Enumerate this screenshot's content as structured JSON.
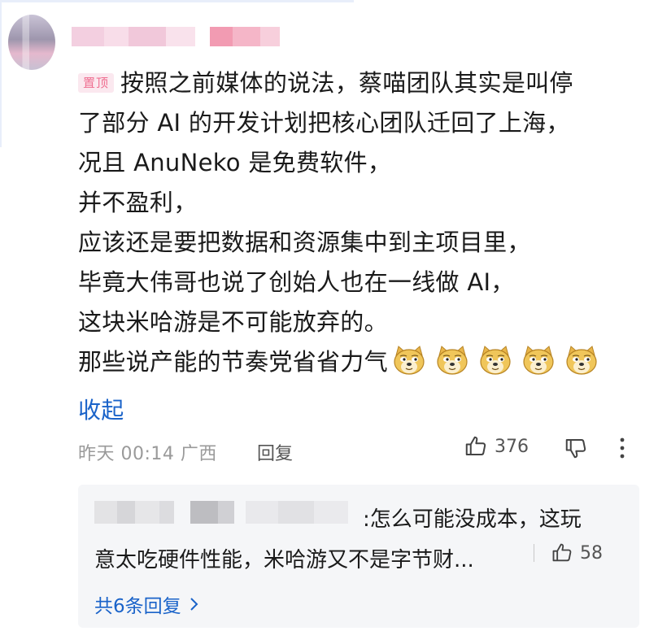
{
  "comment": {
    "pin_label": "置顶",
    "first_line": "按照之前媒体的说法，蔡喵团队其实是叫停",
    "lines": [
      "了部分 AI 的开发计划把核心团队迁回了上海，",
      "况且 AnuNeko 是免费软件，",
      "并不盈利，",
      "应该还是要把数据和资源集中到主项目里，",
      "毕竟大伟哥也说了创始人也在一线做 AI，",
      "这块米哈游是不可能放弃的。"
    ],
    "last_line": "那些说产能的节奏党省省力气",
    "emoji_icon": "doge-emoji",
    "emoji_count": 5,
    "collapse_label": "收起",
    "time": "昨天 00:14 广西",
    "reply_label": "回复",
    "like_count": "376"
  },
  "reply_preview": {
    "line1": "怎么可能没成本，这玩",
    "line2": "意太吃硬件性能，米哈游又不是字节财...",
    "like_count": "58",
    "more_replies": "共6条回复"
  },
  "colors": {
    "link": "#1a63c9",
    "pin_bg": "#fbe8ef",
    "pin_text": "#ef6f91",
    "meta_text": "#9a9a9a",
    "reply_bg": "#f5f6f8"
  }
}
